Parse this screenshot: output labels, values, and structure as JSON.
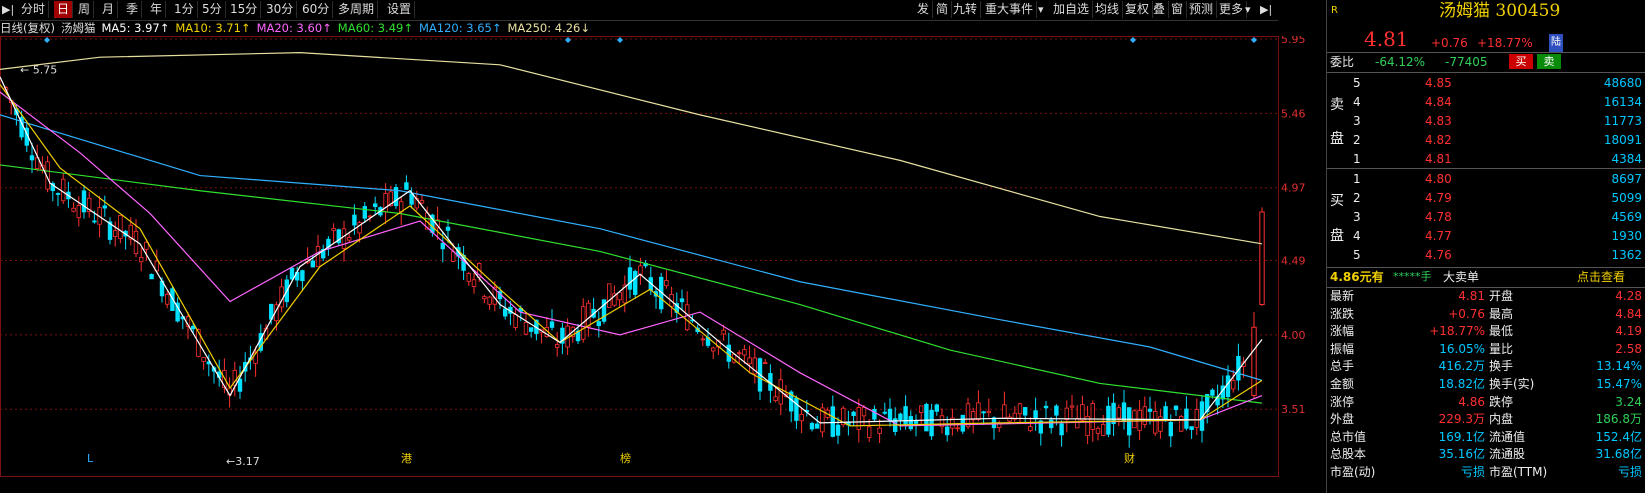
{
  "toolbar": {
    "left_items": [
      "分时",
      "日",
      "周",
      "月",
      "季",
      "年",
      "1分",
      "5分",
      "15分",
      "30分",
      "60分",
      "多周期",
      "设置"
    ],
    "active_index": 1,
    "right_items": [
      "发",
      "简",
      "九转",
      "重大事件",
      "加自选",
      "均线",
      "复权",
      "叠",
      "窗",
      "预测",
      "更多"
    ]
  },
  "legend": {
    "period": "日线(复权)",
    "name": "汤姆猫",
    "items": [
      {
        "text": "MA5: 3.97↑",
        "color": "#ffffff"
      },
      {
        "text": "MA10: 3.71↑",
        "color": "#f0d000"
      },
      {
        "text": "MA20: 3.60↑",
        "color": "#ff66ff"
      },
      {
        "text": "MA60: 3.49↑",
        "color": "#30e030"
      },
      {
        "text": "MA120: 3.65↑",
        "color": "#30b0ff"
      },
      {
        "text": "MA250: 4.26↓",
        "color": "#e8e0a0"
      }
    ]
  },
  "chart_data": {
    "type": "candlestick",
    "y_ticks": [
      "5.95",
      "5.46",
      "4.97",
      "4.49",
      "4.00",
      "3.51"
    ],
    "ylim": [
      3.05,
      5.95
    ],
    "annotations": [
      {
        "text": "5.75",
        "kind": "high"
      },
      {
        "text": "3.17",
        "kind": "low"
      }
    ],
    "bottom_markers": [
      {
        "text": "L",
        "color": "#30b0ff"
      },
      {
        "text": "港",
        "color": "#f0d000"
      },
      {
        "text": "榜",
        "color": "#f0d000"
      },
      {
        "text": "财",
        "color": "#f0d000"
      }
    ],
    "ma250": [
      [
        0,
        5.75
      ],
      [
        100,
        5.83
      ],
      [
        300,
        5.86
      ],
      [
        500,
        5.78
      ],
      [
        700,
        5.45
      ],
      [
        900,
        5.15
      ],
      [
        1100,
        4.78
      ],
      [
        1262,
        4.6
      ]
    ],
    "ma120": [
      [
        0,
        5.45
      ],
      [
        200,
        5.05
      ],
      [
        400,
        4.95
      ],
      [
        600,
        4.7
      ],
      [
        800,
        4.35
      ],
      [
        1000,
        4.1
      ],
      [
        1150,
        3.92
      ],
      [
        1262,
        3.7
      ]
    ],
    "ma60": [
      [
        0,
        5.12
      ],
      [
        200,
        4.95
      ],
      [
        400,
        4.8
      ],
      [
        600,
        4.55
      ],
      [
        800,
        4.2
      ],
      [
        950,
        3.9
      ],
      [
        1100,
        3.68
      ],
      [
        1262,
        3.55
      ]
    ],
    "ma20": [
      [
        0,
        5.6
      ],
      [
        80,
        5.2
      ],
      [
        150,
        4.8
      ],
      [
        230,
        4.22
      ],
      [
        320,
        4.55
      ],
      [
        420,
        4.75
      ],
      [
        520,
        4.15
      ],
      [
        620,
        4.0
      ],
      [
        700,
        4.15
      ],
      [
        800,
        3.75
      ],
      [
        900,
        3.4
      ],
      [
        1050,
        3.42
      ],
      [
        1200,
        3.44
      ],
      [
        1262,
        3.6
      ]
    ],
    "ma10": [
      [
        0,
        5.65
      ],
      [
        60,
        5.1
      ],
      [
        140,
        4.7
      ],
      [
        230,
        3.65
      ],
      [
        320,
        4.45
      ],
      [
        410,
        4.85
      ],
      [
        500,
        4.3
      ],
      [
        560,
        3.95
      ],
      [
        650,
        4.3
      ],
      [
        750,
        3.75
      ],
      [
        850,
        3.4
      ],
      [
        1000,
        3.42
      ],
      [
        1200,
        3.44
      ],
      [
        1262,
        3.7
      ]
    ],
    "ma5": [
      [
        0,
        5.7
      ],
      [
        50,
        5.0
      ],
      [
        140,
        4.6
      ],
      [
        230,
        3.6
      ],
      [
        300,
        4.45
      ],
      [
        410,
        4.95
      ],
      [
        500,
        4.2
      ],
      [
        560,
        3.95
      ],
      [
        640,
        4.4
      ],
      [
        720,
        3.95
      ],
      [
        820,
        3.42
      ],
      [
        1000,
        3.45
      ],
      [
        1200,
        3.44
      ],
      [
        1262,
        3.97
      ]
    ],
    "last_candle": {
      "open": 4.2,
      "close": 4.81,
      "high": 4.84,
      "low": 4.19
    },
    "prev_candle": {
      "open": 3.6,
      "close": 4.05,
      "high": 4.15,
      "low": 3.58
    }
  },
  "quote": {
    "r_mark": "R",
    "title": "汤姆猫 300459",
    "price": "4.81",
    "change": "+0.76",
    "change_pct": "+18.77%",
    "badge": "陆",
    "weibi_label": "委比",
    "weibi_pct": "-64.12%",
    "weibi_num": "-77405",
    "buy_btn": "买",
    "sell_btn": "卖",
    "sell_label": [
      "卖",
      "盘"
    ],
    "buy_label": [
      "买",
      "盘"
    ],
    "asks": [
      {
        "lvl": "5",
        "price": "4.85",
        "vol": "48680"
      },
      {
        "lvl": "4",
        "price": "4.84",
        "vol": "16134"
      },
      {
        "lvl": "3",
        "price": "4.83",
        "vol": "11773"
      },
      {
        "lvl": "2",
        "price": "4.82",
        "vol": "18091"
      },
      {
        "lvl": "1",
        "price": "4.81",
        "vol": "4384"
      }
    ],
    "bids": [
      {
        "lvl": "1",
        "price": "4.80",
        "vol": "8697"
      },
      {
        "lvl": "2",
        "price": "4.79",
        "vol": "5099"
      },
      {
        "lvl": "3",
        "price": "4.78",
        "vol": "4569"
      },
      {
        "lvl": "4",
        "price": "4.77",
        "vol": "1930"
      },
      {
        "lvl": "5",
        "price": "4.76",
        "vol": "1362"
      }
    ],
    "promo": {
      "left": "4.86元有",
      "stars": "*****手",
      "mid": "大卖单",
      "right": "点击查看"
    },
    "stats": [
      {
        "k1": "最新",
        "v1": "4.81",
        "c1": "red",
        "k2": "开盘",
        "v2": "4.28",
        "c2": "red"
      },
      {
        "k1": "涨跌",
        "v1": "+0.76",
        "c1": "red",
        "k2": "最高",
        "v2": "4.84",
        "c2": "red"
      },
      {
        "k1": "涨幅",
        "v1": "+18.77%",
        "c1": "red",
        "k2": "最低",
        "v2": "4.19",
        "c2": "red"
      },
      {
        "k1": "振幅",
        "v1": "16.05%",
        "c1": "cyan",
        "k2": "量比",
        "v2": "2.58",
        "c2": "red"
      },
      {
        "k1": "总手",
        "v1": "416.2万",
        "c1": "cyan",
        "k2": "换手",
        "v2": "13.14%",
        "c2": "cyan"
      },
      {
        "k1": "金额",
        "v1": "18.82亿",
        "c1": "cyan",
        "k2": "换手(实)",
        "v2": "15.47%",
        "c2": "cyan"
      },
      {
        "k1": "涨停",
        "v1": "4.86",
        "c1": "red",
        "k2": "跌停",
        "v2": "3.24",
        "c2": "green"
      },
      {
        "k1": "外盘",
        "v1": "229.3万",
        "c1": "red",
        "k2": "内盘",
        "v2": "186.8万",
        "c2": "green"
      },
      {
        "k1": "总市值",
        "v1": "169.1亿",
        "c1": "cyan",
        "k2": "流通值",
        "v2": "152.4亿",
        "c2": "cyan"
      },
      {
        "k1": "总股本",
        "v1": "35.16亿",
        "c1": "cyan",
        "k2": "流通股",
        "v2": "31.68亿",
        "c2": "cyan"
      },
      {
        "k1": "市盈(动)",
        "v1": "亏损",
        "c1": "cyan",
        "k2": "市盈(TTM)",
        "v2": "亏损",
        "c2": "cyan"
      }
    ]
  },
  "colors": {
    "up": "#ff3030",
    "down": "#00e0ff",
    "grid": "#7a1010"
  }
}
